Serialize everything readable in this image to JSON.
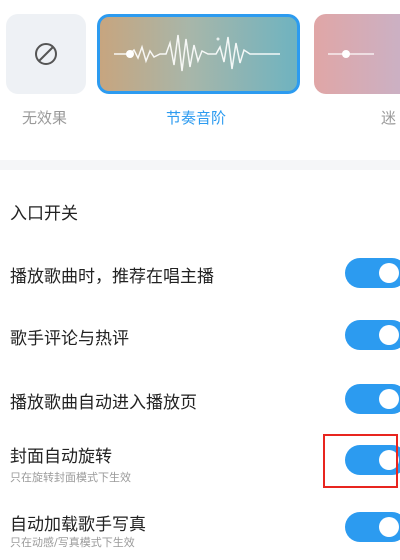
{
  "effects": {
    "items": [
      {
        "label": "无效果",
        "icon": "no-effect-icon",
        "active": false
      },
      {
        "label": "节奏音阶",
        "icon": "waveform",
        "active": true
      },
      {
        "label": "迷",
        "icon": "waveform",
        "active": false
      }
    ]
  },
  "section": {
    "title": "入口开关"
  },
  "settings": [
    {
      "title": "播放歌曲时，推荐在唱主播",
      "subtitle": "",
      "enabled": true
    },
    {
      "title": "歌手评论与热评",
      "subtitle": "",
      "enabled": true
    },
    {
      "title": "播放歌曲自动进入播放页",
      "subtitle": "",
      "enabled": true
    },
    {
      "title": "封面自动旋转",
      "subtitle": "只在旋转封面模式下生效",
      "enabled": true
    },
    {
      "title": "自动加载歌手写真",
      "subtitle": "只在动感/写真模式下生效",
      "enabled": true
    }
  ],
  "colors": {
    "accent": "#2c9bf0",
    "highlight": "#e8251f"
  }
}
